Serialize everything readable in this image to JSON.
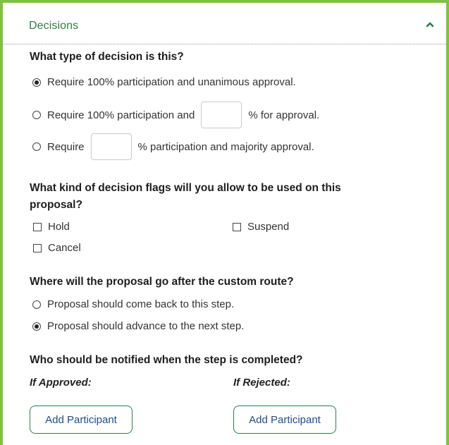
{
  "panel": {
    "title": "Decisions",
    "collapse_icon": "chevron-up-icon",
    "accent_color": "#7fc241",
    "title_color": "#2d7d4a"
  },
  "decision_type": {
    "question": "What type of decision is this?",
    "options": [
      {
        "label": "Require 100% participation and unanimous approval.",
        "checked": true
      },
      {
        "label_before": "Require 100% participation and",
        "label_after": "% for approval.",
        "input_value": "",
        "checked": false
      },
      {
        "label_before": "Require",
        "label_after": "% participation and majority approval.",
        "input_value": "",
        "checked": false
      }
    ]
  },
  "decision_flags": {
    "question_line1": "What kind of decision flags will you allow to be used on this",
    "question_line2": "proposal?",
    "flags": [
      {
        "label": "Hold",
        "checked": false
      },
      {
        "label": "Suspend",
        "checked": false
      },
      {
        "label": "Cancel",
        "checked": false
      }
    ]
  },
  "route": {
    "question": "Where will the proposal go after the custom route?",
    "options": [
      {
        "label": "Proposal should come back to this step.",
        "checked": false
      },
      {
        "label": "Proposal should advance to the next step.",
        "checked": true
      }
    ]
  },
  "notify": {
    "question": "Who should be notified when the step is completed?",
    "approved_label": "If Approved:",
    "rejected_label": "If Rejected:",
    "add_button_label": "Add Participant"
  }
}
